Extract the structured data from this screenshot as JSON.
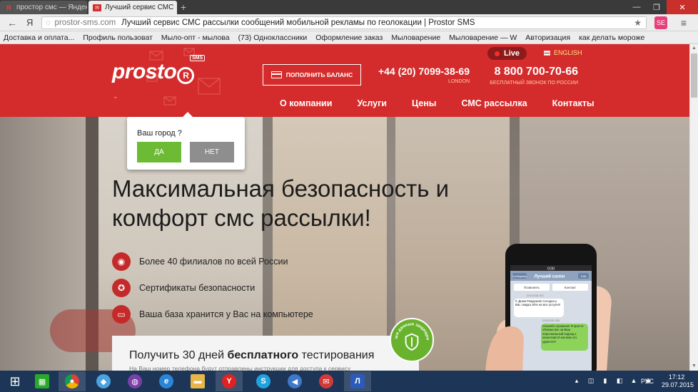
{
  "browser": {
    "tabs": [
      {
        "title": "простор смс — Яндекс",
        "favicon": "yandex-icon"
      },
      {
        "title": "Лучший сервис СМС",
        "favicon": "prostor-mail-icon",
        "active": true
      }
    ],
    "new_tab": "+",
    "window_controls": {
      "minimize": "—",
      "maximize": "❐",
      "close": "✕"
    },
    "back": "←",
    "yandex_button": "Я",
    "address": {
      "domain": "prostor-sms.com",
      "page_title": "Лучший сервис СМС рассылки сообщений мобильной рекламы по геолокации | Prostor SMS"
    },
    "star": "★",
    "extension_label": "SE",
    "menu": "≡",
    "bookmarks": [
      "Доставка и оплата...",
      "Профиль пользоват",
      "Мыло-опт - мылова",
      "(73) Одноклассники",
      "Оформление заказ",
      "Мыловарение",
      "Мыловарение — W",
      "Авторизация",
      "как делать мороже"
    ]
  },
  "header": {
    "logo_text": "prosto",
    "logo_ring_letter": "R",
    "logo_badge": "SMS",
    "dropdown_arrow": "⌄",
    "live_label": "Live",
    "lang_label": "ENGLISH",
    "balance_button": "ПОПОЛНИТЬ БАЛАНС",
    "phones": [
      {
        "number": "+44 (20) 7099-38-69",
        "sub": "LONDON"
      },
      {
        "number": "8 800 700-70-66",
        "sub": "БЕСПЛАТНЫЙ ЗВОНОК ПО РОССИИ"
      }
    ],
    "menu": [
      "О компании",
      "Услуги",
      "Цены",
      "СМС рассылка",
      "Контакты"
    ]
  },
  "city_popup": {
    "question": "Ваш город ?",
    "yes": "ДА",
    "no": "НЕТ"
  },
  "hero": {
    "headline_line1": "Максимальная безопасность и",
    "headline_line2": "комфорт смс рассылки!",
    "features": [
      {
        "icon": "globe-icon",
        "glyph": "◉",
        "text": "Более 40 филиалов по всей России"
      },
      {
        "icon": "certificate-icon",
        "glyph": "✪",
        "text": "Сертификаты безопасности"
      },
      {
        "icon": "computer-icon",
        "glyph": "▭",
        "text": "Ваша база хранится у Вас на компьютере"
      }
    ],
    "trial": {
      "title_prefix": "Получить 30 дней ",
      "title_bold": "бесплатного",
      "title_suffix": " тестирования",
      "subtitle": "На Ваш номер телефона будут отправлены инструкции для доступа к сервису"
    },
    "badge_text": "ваши данные защищены"
  },
  "phone_screen": {
    "time": "0:00",
    "back_label": "Сообщения",
    "contact_name": "Лучший салон",
    "edit_label": "Edit",
    "call_label": "Позвонить",
    "contact_label": "Контакт",
    "date_1": "20.04.2015, 8:21",
    "msg_in": "С Днем Рождения! Сегодня у Вас скидка 30% на все услуги!!!",
    "date_2": "20.04.2015, 9:35",
    "msg_out": "Спасибо огромное! Я просто обожаю вас за Ваш персональный подход к клиентам! И как вам это удается?!"
  },
  "taskbar": {
    "items": [
      {
        "name": "start-button",
        "glyph": "⊞",
        "color": "#1d3556"
      },
      {
        "name": "taskbar-store-icon",
        "glyph": "▦",
        "color": "#2aa82a"
      },
      {
        "name": "taskbar-chrome-icon",
        "glyph": "●",
        "color": "#d7452f"
      },
      {
        "name": "taskbar-app-icon",
        "glyph": "◆",
        "color": "#4aa3df"
      },
      {
        "name": "taskbar-browser-icon",
        "glyph": "◍",
        "color": "#7a3fa8"
      },
      {
        "name": "taskbar-ie-icon",
        "glyph": "e",
        "color": "#2a86d6"
      },
      {
        "name": "taskbar-explorer-icon",
        "glyph": "▬",
        "color": "#e8b648"
      },
      {
        "name": "taskbar-yandex-icon",
        "glyph": "Y",
        "color": "#e02222"
      },
      {
        "name": "taskbar-skype-icon",
        "glyph": "S",
        "color": "#1ea3df"
      },
      {
        "name": "taskbar-media-icon",
        "glyph": "◀",
        "color": "#3e78c8"
      },
      {
        "name": "taskbar-mail-icon",
        "glyph": "✉",
        "color": "#d23a3a"
      },
      {
        "name": "taskbar-app2-icon",
        "glyph": "Л",
        "color": "#2b5bb8"
      }
    ],
    "tray": [
      "▴",
      "◫",
      "▮",
      "◧",
      "▲",
      "◉"
    ],
    "lang": "РУС",
    "time": "17:12",
    "date": "29.07.2015"
  }
}
